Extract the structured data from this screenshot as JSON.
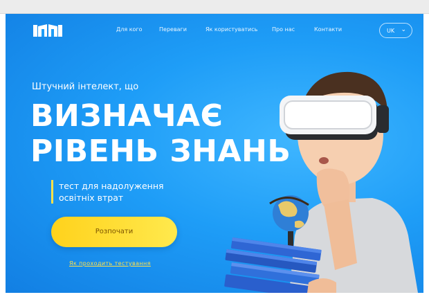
{
  "nav": {
    "links": [
      "Для кого",
      "Переваги",
      "Як користуватись",
      "Про нас",
      "Контакти"
    ],
    "language": "UK"
  },
  "hero": {
    "subtitle": "Штучний інтелект, що",
    "headline_line1": "ВИЗНАЧАЄ",
    "headline_line2": "РІВЕНЬ ЗНАНЬ",
    "tagline_line1": "тест для надолуження",
    "tagline_line2": "освітніх втрат",
    "cta_label": "Розпочати",
    "how_link": "Як проходить тестування"
  },
  "colors": {
    "background": "#1e9df7",
    "accent_yellow": "#ffd21c",
    "text": "#ffffff"
  },
  "icons": {
    "logo": "book-logo-icon",
    "language_chevron": "chevron-down-icon",
    "hero_image": "boy-vr-headset-globe-books"
  }
}
